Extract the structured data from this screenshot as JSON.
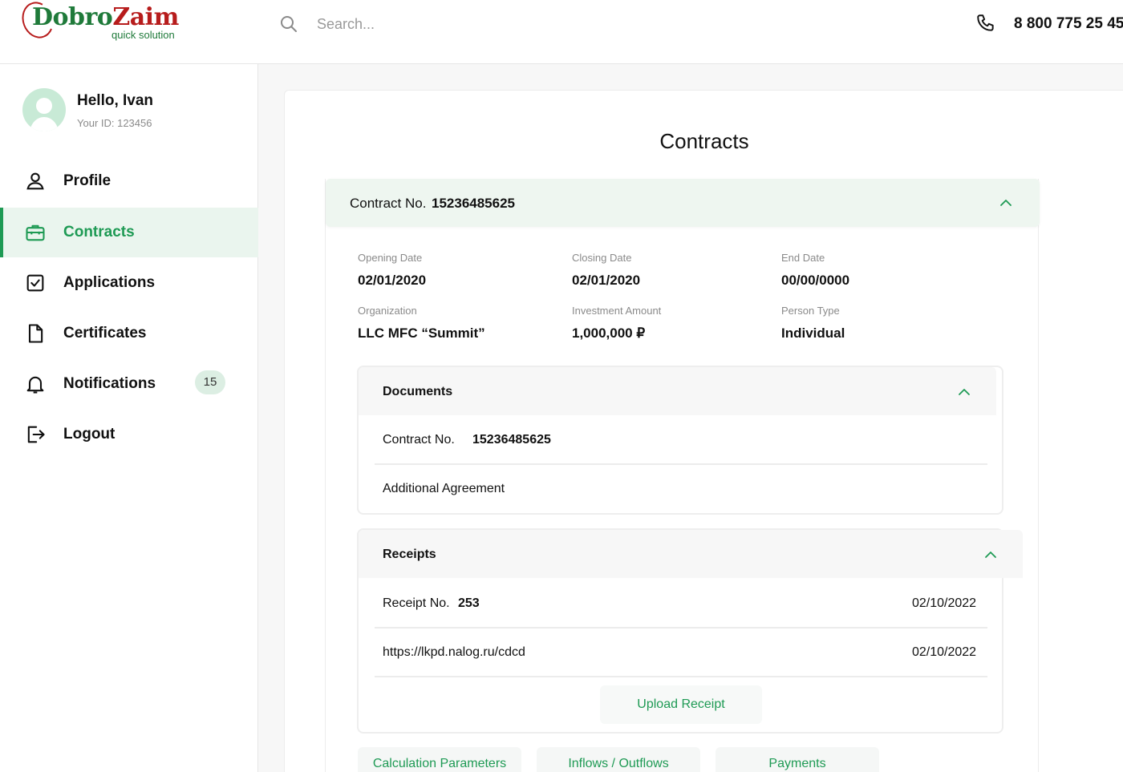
{
  "brand": {
    "logo_primary": "Dobro",
    "logo_secondary": "Zaim",
    "tagline": "quick solution",
    "green": "#1e9a54",
    "red": "#b71c1c"
  },
  "header": {
    "search_placeholder": "Search...",
    "phone": "8 800 775 25 45"
  },
  "user": {
    "greeting": "Hello, Ivan",
    "id_text": "Your ID: 123456"
  },
  "sidebar": {
    "items": [
      {
        "label": "Profile",
        "icon": "user-icon",
        "active": false
      },
      {
        "label": "Contracts",
        "icon": "briefcase-icon",
        "active": true
      },
      {
        "label": "Applications",
        "icon": "checkbox-icon",
        "active": false
      },
      {
        "label": "Certificates",
        "icon": "document-icon",
        "active": false
      },
      {
        "label": "Notifications",
        "icon": "bell-icon",
        "active": false,
        "badge": "15"
      },
      {
        "label": "Logout",
        "icon": "logout-icon",
        "active": false
      }
    ]
  },
  "main": {
    "title": "Contracts",
    "contract": {
      "label": "Contract No.",
      "number": "15236485625",
      "fields": [
        {
          "label": "Opening Date",
          "value": "02/01/2020"
        },
        {
          "label": "Closing Date",
          "value": "02/01/2020"
        },
        {
          "label": "End Date",
          "value": "00/00/0000"
        },
        {
          "label": "Organization",
          "value": "LLC MFC “Summit”"
        },
        {
          "label": "Investment Amount",
          "value": "1,000,000 ₽"
        },
        {
          "label": "Person Type",
          "value": "Individual"
        }
      ]
    },
    "documents": {
      "title": "Documents",
      "items": [
        {
          "label": "Contract No.",
          "value": "15236485625"
        },
        {
          "label": "Additional Agreement"
        }
      ]
    },
    "receipts": {
      "title": "Receipts",
      "items": [
        {
          "label": "Receipt No.",
          "value": "253",
          "date": "02/10/2022"
        },
        {
          "label": "https://lkpd.nalog.ru/cdcd",
          "date": "02/10/2022"
        }
      ],
      "upload_label": "Upload Receipt"
    },
    "tabs": [
      "Calculation Parameters",
      "Inflows / Outflows",
      "Payments"
    ]
  }
}
